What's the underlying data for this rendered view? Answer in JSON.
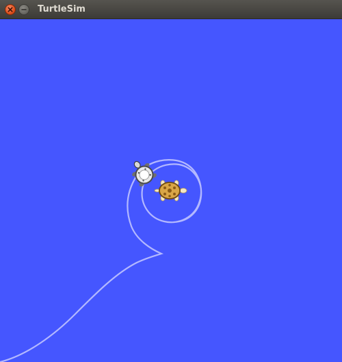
{
  "window": {
    "title": "TurtleSim",
    "buttons": [
      "close-icon",
      "minimize-icon"
    ]
  },
  "canvas": {
    "background": "#4556ff",
    "pen_color": "#b3b8ff"
  },
  "turtles": [
    {
      "name": "turtle-grey",
      "icon": "turtle-icon"
    },
    {
      "name": "turtle-orange",
      "icon": "turtle-icon"
    }
  ]
}
